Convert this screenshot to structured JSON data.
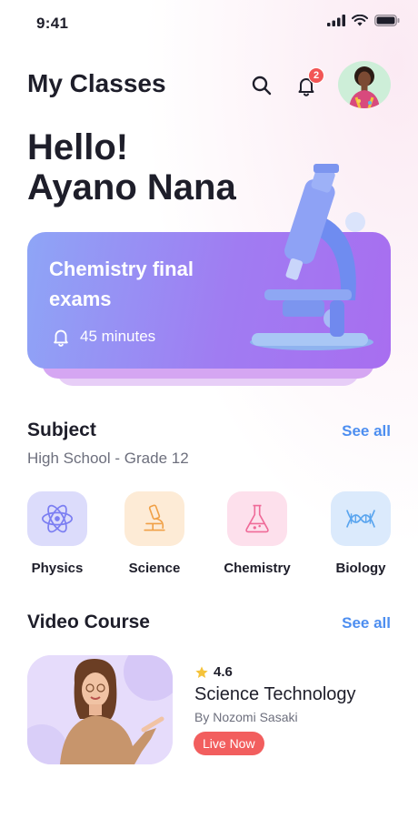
{
  "status_bar": {
    "time": "9:41"
  },
  "header": {
    "title": "My Classes",
    "notification_count": "2"
  },
  "greeting": {
    "line1": "Hello!",
    "line2": "Ayano Nana"
  },
  "exam_card": {
    "title": "Chemistry final exams",
    "duration": "45 minutes"
  },
  "subject_section": {
    "title": "Subject",
    "see_all": "See all",
    "subtitle": "High School - Grade 12",
    "items": [
      {
        "label": "Physics",
        "icon": "atom-icon",
        "color": "#dcdcfb"
      },
      {
        "label": "Science",
        "icon": "microscope-icon",
        "color": "#fdebd6"
      },
      {
        "label": "Chemistry",
        "icon": "flask-icon",
        "color": "#fde0ec"
      },
      {
        "label": "Biology",
        "icon": "dna-icon",
        "color": "#dbeafc"
      }
    ]
  },
  "video_section": {
    "title": "Video Course",
    "see_all": "See all",
    "course": {
      "rating": "4.6",
      "title": "Science Technology",
      "author": "By Nozomi Sasaki",
      "badge": "Live Now"
    }
  },
  "colors": {
    "accent_blue": "#4d8ef0",
    "live_red": "#f25e5e",
    "card_gradient_start": "#8ea5f6",
    "card_gradient_end": "#a86ef0"
  }
}
